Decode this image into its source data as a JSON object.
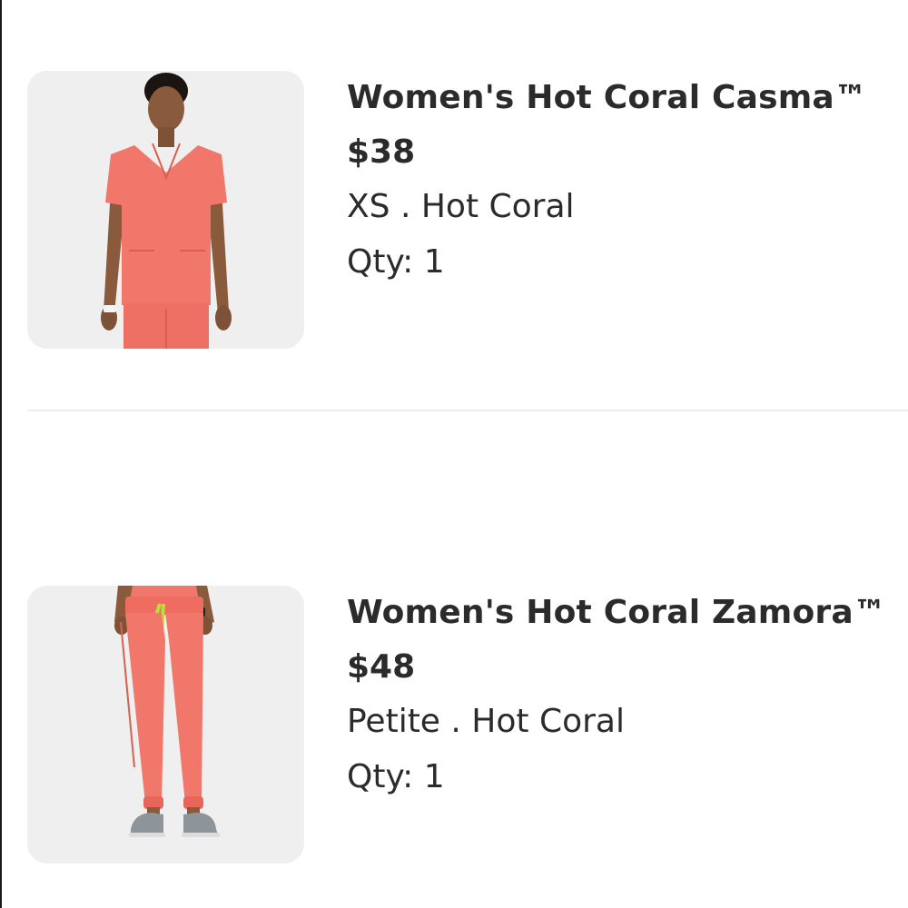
{
  "cart": {
    "items": [
      {
        "title": "Women's Hot Coral Casma™",
        "price": "$38",
        "variant": "XS . Hot Coral",
        "qty": "Qty: 1",
        "image": "coral-scrub-top-photo"
      },
      {
        "title": "Women's Hot Coral Zamora™",
        "price": "$48",
        "variant": "Petite . Hot Coral",
        "qty": "Qty: 1",
        "image": "coral-jogger-pants-photo"
      }
    ]
  },
  "colors": {
    "product_coral": "#f0776a",
    "text": "#2b2b2b",
    "thumb_bg": "#f2f2f2",
    "divider": "#ededed"
  }
}
